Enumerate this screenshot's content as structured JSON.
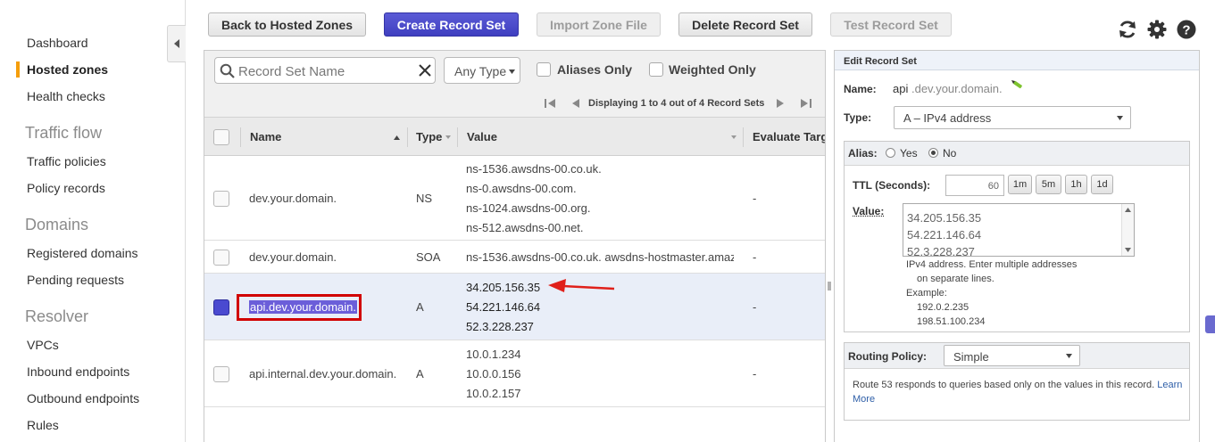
{
  "sidebar": {
    "items": [
      {
        "label": "Dashboard"
      },
      {
        "label": "Hosted zones"
      },
      {
        "label": "Health checks"
      },
      {
        "label": "Traffic policies"
      },
      {
        "label": "Policy records"
      },
      {
        "label": "Registered domains"
      },
      {
        "label": "Pending requests"
      },
      {
        "label": "VPCs"
      },
      {
        "label": "Inbound endpoints"
      },
      {
        "label": "Outbound endpoints"
      },
      {
        "label": "Rules"
      }
    ],
    "sections": [
      "Traffic flow",
      "Domains",
      "Resolver"
    ],
    "active_item": "Hosted zones"
  },
  "toolbar": {
    "back": "Back to Hosted Zones",
    "create": "Create Record Set",
    "import": "Import Zone File",
    "delete": "Delete Record Set",
    "test": "Test Record Set"
  },
  "filter": {
    "search_placeholder": "Record Set Name",
    "type_select": "Any Type",
    "aliases_only": "Aliases Only",
    "weighted_only": "Weighted Only",
    "pager_text": "Displaying 1 to 4 out of 4 Record Sets"
  },
  "table": {
    "columns": [
      "Name",
      "Type",
      "Value",
      "Evaluate Targ"
    ],
    "rows": [
      {
        "name": "dev.your.domain.",
        "type": "NS",
        "values": [
          "ns-1536.awsdns-00.co.uk.",
          "ns-0.awsdns-00.com.",
          "ns-1024.awsdns-00.org.",
          "ns-512.awsdns-00.net."
        ],
        "evaluate": "-",
        "selected": false
      },
      {
        "name": "dev.your.domain.",
        "type": "SOA",
        "values": [
          "ns-1536.awsdns-00.co.uk. awsdns-hostmaster.amaz"
        ],
        "evaluate": "-",
        "selected": false
      },
      {
        "name": "api.dev.your.domain.",
        "type": "A",
        "values": [
          "34.205.156.35",
          "54.221.146.64",
          "52.3.228.237"
        ],
        "evaluate": "-",
        "selected": true
      },
      {
        "name": "api.internal.dev.your.domain.",
        "type": "A",
        "values": [
          "10.0.1.234",
          "10.0.0.156",
          "10.0.2.157"
        ],
        "evaluate": "-",
        "selected": false
      }
    ]
  },
  "edit": {
    "title": "Edit Record Set",
    "name_label": "Name:",
    "name_prefix": "api",
    "name_suffix": ".dev.your.domain.",
    "type_label": "Type:",
    "type_value": "A – IPv4 address",
    "alias_label": "Alias:",
    "alias_yes": "Yes",
    "alias_no": "No",
    "alias_selected": "No",
    "ttl_label": "TTL (Seconds):",
    "ttl_value": "60",
    "ttl_buttons": [
      "1m",
      "5m",
      "1h",
      "1d"
    ],
    "value_label": "Value:",
    "value_lines": [
      "34.205.156.35",
      "54.221.146.64",
      "52.3.228.237"
    ],
    "help": [
      "IPv4 address. Enter multiple addresses",
      "on separate lines.",
      "Example:",
      "192.0.2.235",
      "198.51.100.234"
    ],
    "routing_label": "Routing Policy:",
    "routing_value": "Simple",
    "routing_help_line1": "Route 53 responds to queries based only on the values in this record.",
    "routing_link_1": "Learn",
    "routing_link_2": "More"
  },
  "colors": {
    "primary": "#3f3fc0",
    "active_nav": "#f59e0b",
    "highlight_border": "#d10000",
    "arrow": "#e0201a"
  }
}
